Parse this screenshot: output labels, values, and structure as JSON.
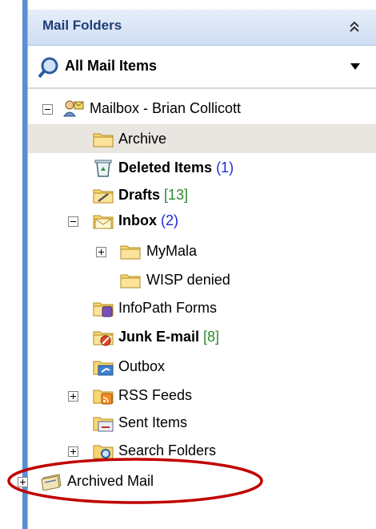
{
  "header": {
    "title": "Mail Folders",
    "collapse_icon": "double-chevron-up-icon"
  },
  "view_selector": {
    "label": "All Mail Items",
    "icon": "search-folder-icon"
  },
  "tree": {
    "mailbox": {
      "label": "Mailbox - Brian Collicott"
    },
    "archive": {
      "label": "Archive"
    },
    "deleted": {
      "label": "Deleted Items",
      "count": "(1)"
    },
    "drafts": {
      "label": "Drafts",
      "count": "[13]"
    },
    "inbox": {
      "label": "Inbox",
      "count": "(2)"
    },
    "mymala": {
      "label": "MyMala"
    },
    "wisp": {
      "label": "WISP denied"
    },
    "infopath": {
      "label": "InfoPath Forms"
    },
    "junk": {
      "label": "Junk E-mail",
      "count": "[8]"
    },
    "outbox": {
      "label": "Outbox"
    },
    "rss": {
      "label": "RSS Feeds"
    },
    "sent": {
      "label": "Sent Items"
    },
    "search": {
      "label": "Search Folders"
    },
    "archived_mail": {
      "label": "Archived Mail"
    }
  },
  "colors": {
    "accent": "#5a8fd6",
    "highlight": "#e9e6e1",
    "annotation": "#c00000"
  }
}
